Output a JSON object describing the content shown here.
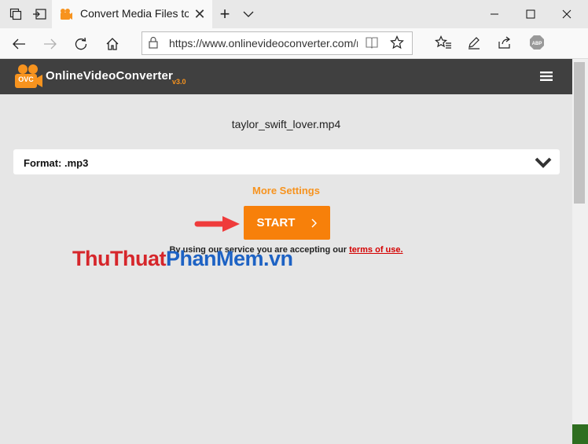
{
  "browser": {
    "tab_title": "Convert Media Files to Mo",
    "url": "https://www.onlinevideoconverter.com/m"
  },
  "site": {
    "logo_badge": "OVC",
    "logo_name": "OnlineVideoConverter",
    "logo_version": "v3.0"
  },
  "converter": {
    "filename": "taylor_swift_lover.mp4",
    "format_label": "Format: .mp3",
    "more_settings": "More Settings",
    "start_label": "START",
    "terms_prefix": "By using our service you are accepting our ",
    "terms_link": "terms of use."
  },
  "watermark": {
    "part1": "ThuThuat",
    "part2": "PhanMem",
    "part3": ".vn"
  },
  "colors": {
    "accent_orange": "#f7800a",
    "header_dark": "#404040",
    "link_red": "#d40000"
  },
  "icons": [
    "tab-actions-icon",
    "set-aside-icon",
    "favicon",
    "close-icon",
    "new-tab-icon",
    "chevron-down-icon",
    "minimize-icon",
    "maximize-icon",
    "close-window-icon",
    "back-icon",
    "forward-icon",
    "refresh-icon",
    "home-icon",
    "lock-icon",
    "reading-view-icon",
    "star-icon",
    "favorites-icon",
    "pen-icon",
    "share-icon",
    "adblock-icon",
    "hamburger-icon",
    "red-arrow-icon"
  ]
}
